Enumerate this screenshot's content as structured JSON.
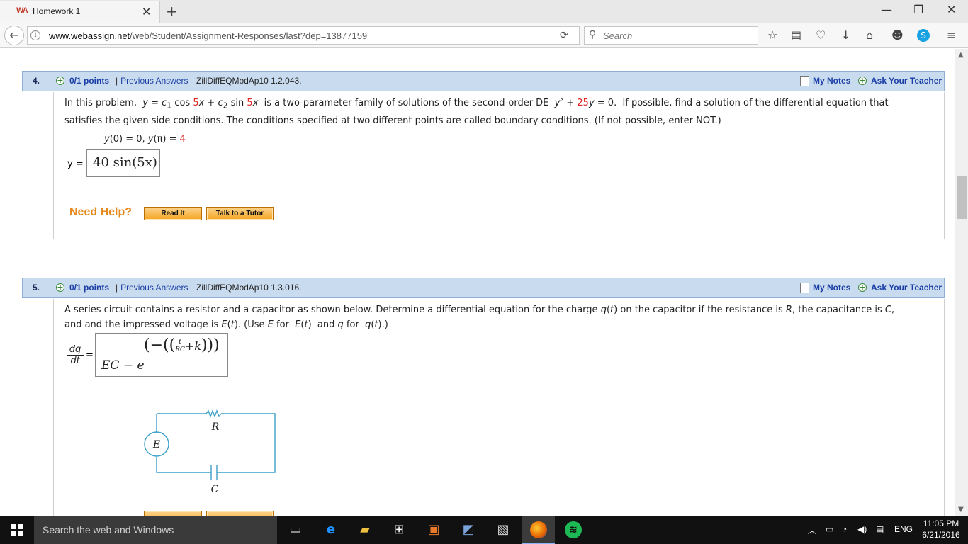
{
  "browser": {
    "tab_title": "Homework 1",
    "tab_favicon": "WA",
    "url_domain": "www.webassign.net",
    "url_path": "/web/Student/Assignment-Responses/last?dep=13877159",
    "search_placeholder": "Search"
  },
  "questions": [
    {
      "number": "4.",
      "points": "0/1 points",
      "prev_answers": "Previous Answers",
      "problem_id": "ZillDiffEQModAp10 1.2.043.",
      "my_notes": "My Notes",
      "ask_teacher": "Ask Your Teacher",
      "text_1": "In this problem,",
      "text_2": "is a two-parameter family of solutions of the second-order DE",
      "text_3": "If possible, find a solution of the differential equation that",
      "text_line2": "satisfies the given side conditions. The conditions specified at two different points are called boundary conditions. (If not possible, enter NOT.)",
      "answer_label": "y =",
      "answer_value": "40 sin(5x)",
      "need_help": "Need Help?",
      "read_it": "Read It",
      "talk_tutor": "Talk to a Tutor"
    },
    {
      "number": "5.",
      "points": "0/1 points",
      "prev_answers": "Previous Answers",
      "problem_id": "ZillDiffEQModAp10 1.3.016.",
      "my_notes": "My Notes",
      "ask_teacher": "Ask Your Teacher",
      "text_1": "A series circuit contains a resistor and a capacitor as shown below. Determine a differential equation for the charge",
      "text_2": "on the capacitor if the resistance is",
      "text_3": "the capacitance is",
      "text_4": "and the impressed voltage is",
      "text_5": "(Use",
      "text_6": "for",
      "text_7": "and",
      "text_8": "for",
      "answer_lhs_num": "dq",
      "answer_lhs_den": "dt",
      "answer_value": "EC − e^(−((t/(RC)+k)))",
      "circuit": {
        "resistor_label": "R",
        "source_label": "E",
        "capacitor_label": "C"
      }
    }
  ],
  "taskbar": {
    "search_text": "Search the web and Windows",
    "language": "ENG",
    "time": "11:05 PM",
    "date": "6/21/2016"
  },
  "colors": {
    "question_bar": "#c9dcef",
    "link": "#1a3ea6",
    "highlight_red": "#d22222",
    "need_help": "#e68a1e",
    "circuit_line": "#3aa0c8"
  }
}
